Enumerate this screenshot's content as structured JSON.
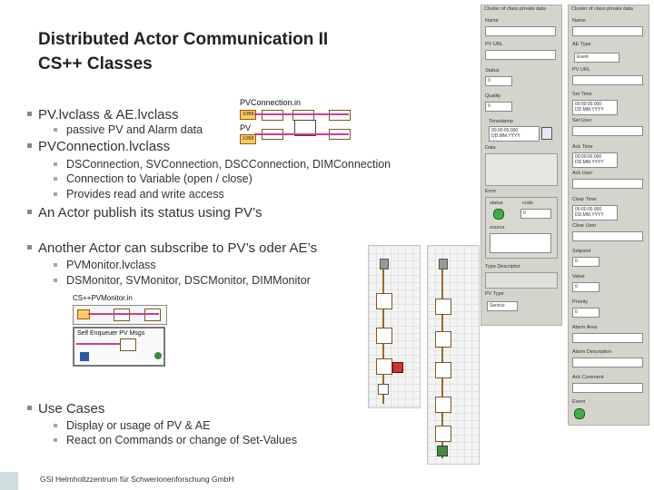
{
  "slide": {
    "title_line1": "Distributed Actor Communication II",
    "title_line2": "CS++ Classes",
    "bullets": [
      {
        "text": "PV.lvclass & AE.lvclass",
        "subs": [
          "passive PV and Alarm data"
        ]
      },
      {
        "text": "PVConnection.lvclass",
        "subs": [
          "DSConnection, SVConnection, DSCConnection, DIMConnection",
          "Connection to Variable (open / close)",
          "Provides read and write access"
        ]
      },
      {
        "text": "An Actor publish its status using PV’s",
        "subs": []
      },
      {
        "text": "Another Actor can subscribe to PV’s oder AE’s",
        "subs": [
          "PVMonitor.lvclass",
          "DSMonitor, SVMonitor, DSCMonitor, DIMMonitor"
        ]
      },
      {
        "text": "Use Cases",
        "subs": [
          "Display or usage of PV & AE",
          "React on Commands or change of Set-Values"
        ]
      }
    ],
    "footer": "GSI Helmholtzzentrum für Schwerionenforschung GmbH"
  },
  "diagram_pvconnection": {
    "title": "PVConnection.in",
    "pv_label": "PV",
    "const_label": "1OB8"
  },
  "diagram_pvmonitor": {
    "title": "CS++PVMonitor.in",
    "loop_label": "Self Enqueuer PV Msgs"
  },
  "panel_left": {
    "header": "Cluster of class private data",
    "fields": [
      {
        "label": "Name",
        "value": ""
      },
      {
        "label": "PV URL",
        "value": ""
      },
      {
        "label": "Status",
        "value": "0"
      },
      {
        "label": "Quality",
        "value": "0"
      },
      {
        "label": "Timestamp",
        "value": "00:00:00.000\nDD.MM.YYYY"
      },
      {
        "label": "Data",
        "value": ""
      },
      {
        "label": "Error",
        "value": ""
      },
      {
        "label": "Type Descriptor",
        "value": ""
      },
      {
        "label": "PV Type",
        "value": "Service"
      }
    ],
    "error": {
      "status_label": "status",
      "code_label": "code",
      "code_value": "0",
      "source_label": "source"
    }
  },
  "panel_right": {
    "header": "Cluster of class private data",
    "fields": [
      {
        "label": "Name",
        "value": ""
      },
      {
        "label": "AE Type",
        "value": "Event"
      },
      {
        "label": "PV URL",
        "value": ""
      },
      {
        "label": "Set Time",
        "value": "00:00:00.000\nDD.MM.YYYY"
      },
      {
        "label": "Set User",
        "value": ""
      },
      {
        "label": "Ack Time",
        "value": "00:00:00.000\nDD.MM.YYYY"
      },
      {
        "label": "Ack User",
        "value": ""
      },
      {
        "label": "Clear Time",
        "value": "00:00:00.000\nDD.MM.YYYY"
      },
      {
        "label": "Clear User",
        "value": ""
      },
      {
        "label": "Setpoint",
        "value": "0"
      },
      {
        "label": "Value",
        "value": "0"
      },
      {
        "label": "Priority",
        "value": "0"
      },
      {
        "label": "Alarm Area",
        "value": ""
      },
      {
        "label": "Alarm Description",
        "value": ""
      },
      {
        "label": "Ack Comment",
        "value": ""
      },
      {
        "label": "Event",
        "value": ""
      }
    ]
  }
}
